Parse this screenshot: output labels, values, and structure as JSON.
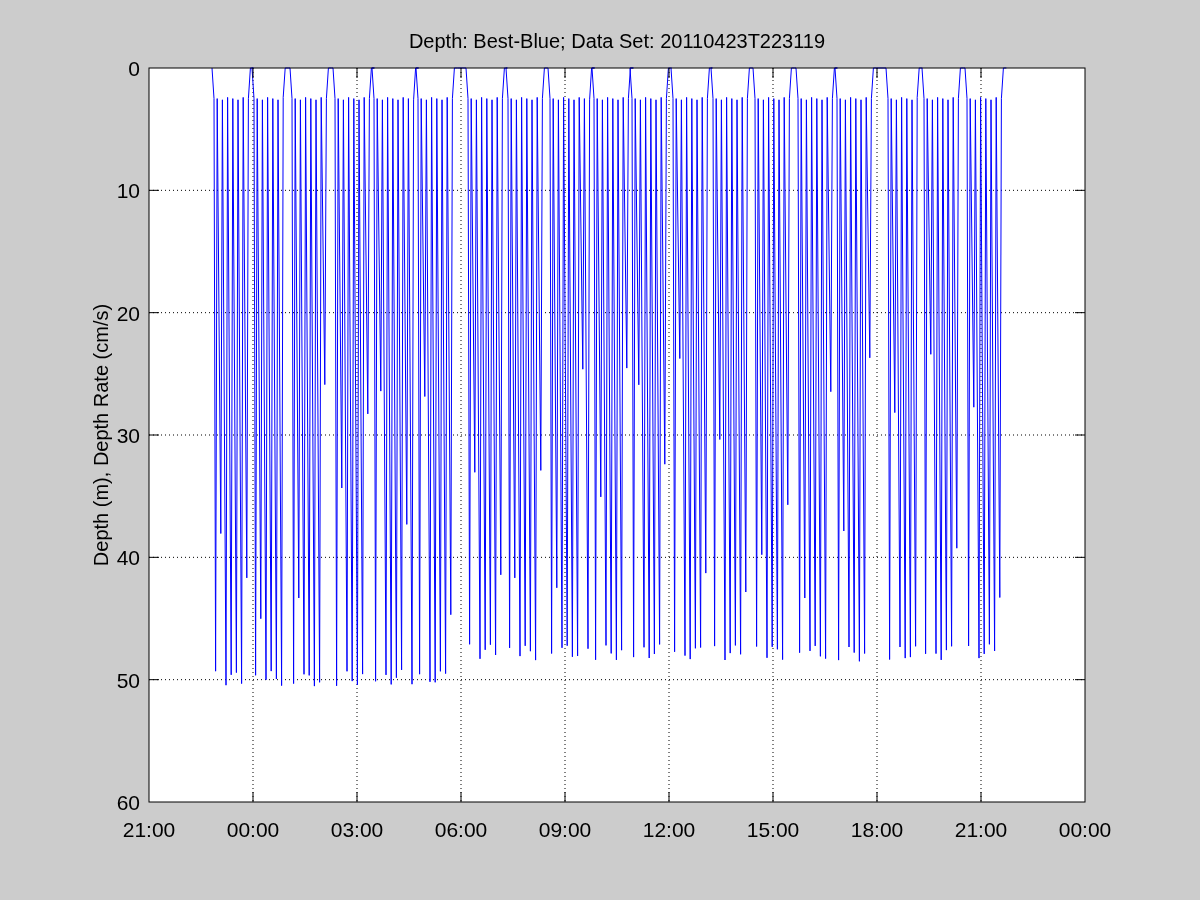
{
  "figure": {
    "title": "Depth: Best-Blue; Data Set: 20110423T223119",
    "ylabel": "Depth (m), Depth Rate (cm/s)",
    "xtick_labels": [
      "21:00",
      "00:00",
      "03:00",
      "06:00",
      "09:00",
      "12:00",
      "15:00",
      "18:00",
      "21:00",
      "00:00"
    ],
    "ytick_labels": [
      "0",
      "10",
      "20",
      "30",
      "40",
      "50",
      "60"
    ]
  }
}
